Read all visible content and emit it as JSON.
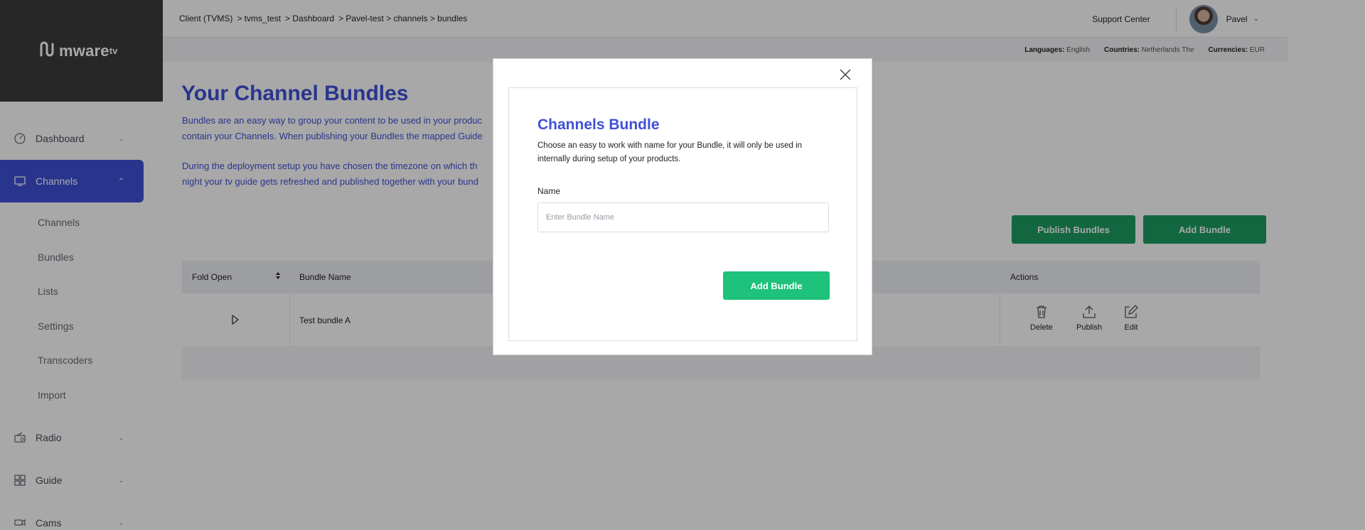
{
  "app": {
    "logo_text": "mware",
    "logo_sup": "tv"
  },
  "sidebar": {
    "items": [
      {
        "label": "Dashboard",
        "icon": "dashboard-gauge-icon",
        "expanded": false
      },
      {
        "label": "Channels",
        "icon": "monitor-icon",
        "expanded": true,
        "active": true
      },
      {
        "label": "Radio",
        "icon": "radio-icon",
        "expanded": false
      },
      {
        "label": "Guide",
        "icon": "guide-grid-icon",
        "expanded": false
      },
      {
        "label": "Cams",
        "icon": "camera-icon",
        "expanded": false
      }
    ],
    "channels_subitems": [
      "Channels",
      "Bundles",
      "Lists",
      "Settings",
      "Transcoders",
      "Import"
    ]
  },
  "topbar": {
    "breadcrumb": [
      "Client (TVMS)",
      "> tvms_test",
      ">  Dashboard",
      "> Pavel-test > channels > bundles"
    ],
    "support_label": "Support Center",
    "user_name": "Pavel"
  },
  "subbar": {
    "languages_label": "Languages:",
    "languages_value": "English",
    "countries_label": "Countries:",
    "countries_value": "Netherlands The",
    "currencies_label": "Currencies:",
    "currencies_value": "EUR"
  },
  "main": {
    "title": "Your Channel Bundles",
    "desc_line1": "Bundles are an easy way to group your content to be used in your produc",
    "desc_line2": "contain your Channels. When publishing your Bundles the mapped Guide",
    "desc_line3": "During the deployment setup you have chosen the timezone on which th",
    "desc_line4": "night your tv guide gets refreshed and published together with your bund",
    "publish_bundles_label": "Publish Bundles",
    "add_bundle_label": "Add Bundle"
  },
  "table": {
    "columns": {
      "fold_open": "Fold Open",
      "bundle_name": "Bundle Name",
      "actions": "Actions"
    },
    "rows": [
      {
        "bundle_name": "Test bundle A"
      }
    ],
    "actions": {
      "delete": "Delete",
      "publish": "Publish",
      "edit": "Edit"
    }
  },
  "modal": {
    "title": "Channels Bundle",
    "description": "Choose an easy to work with name for your Bundle, it will only be used in internally during setup of your products.",
    "name_label": "Name",
    "name_value": "",
    "name_placeholder": "Enter Bundle Name",
    "submit_label": "Add Bundle"
  },
  "colors": {
    "brand_blue": "#3f51d7",
    "green": "#1ec27a",
    "dark_green": "#1c9d61",
    "sidebar_dark": "#3c3c3c"
  }
}
